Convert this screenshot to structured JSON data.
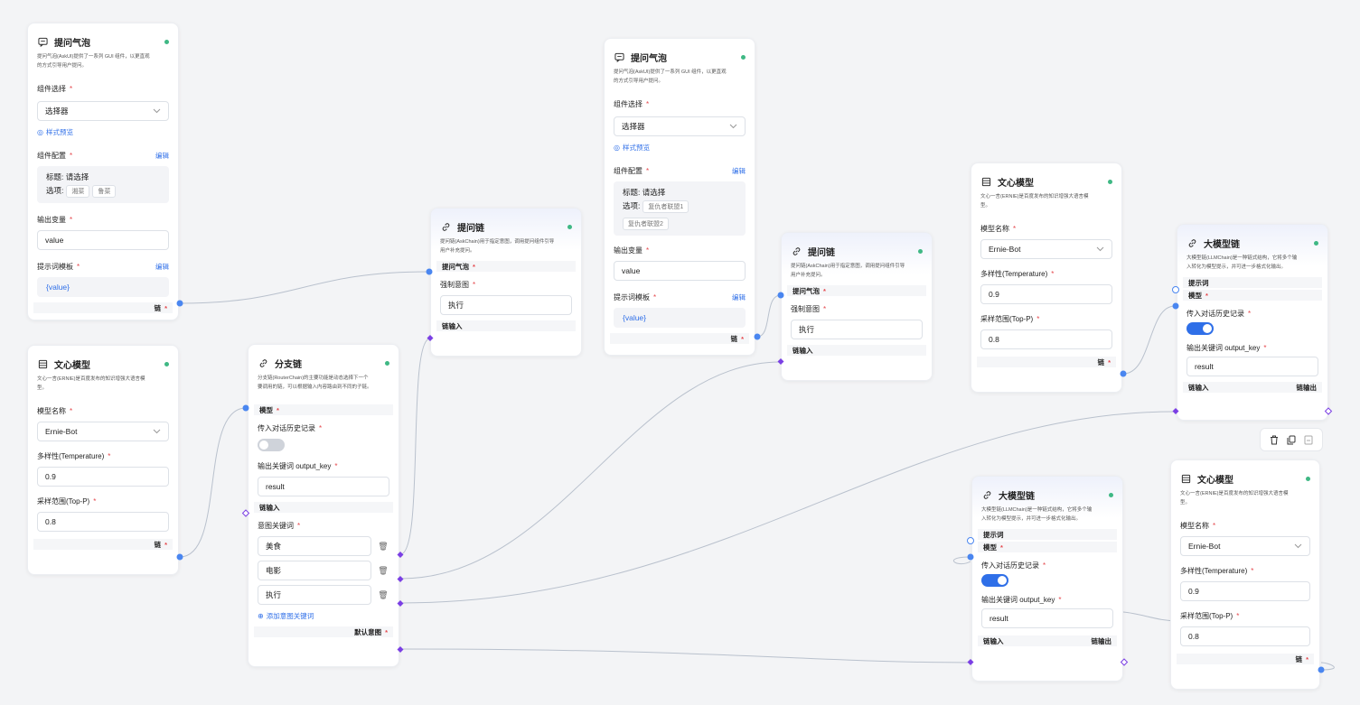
{
  "nodes": {
    "askui1": {
      "title": "提问气泡",
      "desc": [
        "提问气泡(AskUI)提供了一系列 GUI 组件，以更直观",
        "的方式引导用户提问。"
      ],
      "component_label": "组件选择",
      "component_value": "选择器",
      "style_preview": "样式预览",
      "config_label": "组件配置",
      "edit": "编辑",
      "config_title": "标题: 请选择",
      "config_options_label": "选项:",
      "options": [
        "湘菜",
        "鲁菜"
      ],
      "output_label": "输出变量",
      "output_value": "value",
      "template_label": "提示词模板",
      "template_value": "{value}",
      "chain_port": "链"
    },
    "askui2": {
      "title": "提问气泡",
      "desc": [
        "提问气泡(AskUI)提供了一系列 GUI 组件，以更直观",
        "的方式引导用户提问。"
      ],
      "component_label": "组件选择",
      "component_value": "选择器",
      "style_preview": "样式预览",
      "config_label": "组件配置",
      "edit": "编辑",
      "config_title": "标题: 请选择",
      "config_options_label": "选项:",
      "options": [
        "复仇者联盟1",
        "复仇者联盟2"
      ],
      "output_label": "输出变量",
      "output_value": "value",
      "template_label": "提示词模板",
      "template_value": "{value}",
      "chain_port": "链"
    },
    "wenxin1": {
      "title": "文心模型",
      "desc": [
        "文心一言(ERNIE)是百度发布的知识增强大语言模",
        "型。"
      ],
      "model_label": "模型名称",
      "model_value": "Ernie-Bot",
      "temp_label": "多样性(Temperature)",
      "temp_value": "0.9",
      "topp_label": "采样范围(Top-P)",
      "topp_value": "0.8",
      "chain_port": "链"
    },
    "wenxin2": {
      "title": "文心模型",
      "desc": [
        "文心一言(ERNIE)是百度发布的知识增强大语言模",
        "型。"
      ],
      "model_label": "模型名称",
      "model_value": "Ernie-Bot",
      "temp_label": "多样性(Temperature)",
      "temp_value": "0.9",
      "topp_label": "采样范围(Top-P)",
      "topp_value": "0.8",
      "chain_port": "链"
    },
    "wenxin3": {
      "title": "文心模型",
      "desc": [
        "文心一言(ERNIE)是百度发布的知识增强大语言模",
        "型。"
      ],
      "model_label": "模型名称",
      "model_value": "Ernie-Bot",
      "temp_label": "多样性(Temperature)",
      "temp_value": "0.9",
      "topp_label": "采样范围(Top-P)",
      "topp_value": "0.8",
      "chain_port": "链"
    },
    "router": {
      "title": "分支链",
      "desc": [
        "分支链(RouterChain)的主要功能是动态选择下一个",
        "要调用的链，可以根据输入内容路由到不同的子链。"
      ],
      "model_port": "模型",
      "history_label": "传入对话历史记录",
      "history_on": false,
      "output_key_label": "输出关键词 output_key",
      "output_key_value": "result",
      "chain_in": "链输入",
      "intent_label": "意图关键词",
      "keywords": [
        "美食",
        "电影",
        "执行"
      ],
      "add_keyword": "添加意图关键词",
      "default_intent": "默认意图"
    },
    "askchain1": {
      "title": "提问链",
      "desc": [
        "提问链(AskChain)用于指定意图，调用提问组件引导",
        "用户补充提问。"
      ],
      "askui_port": "提问气泡",
      "intent_label": "强制意图",
      "intent_value": "执行",
      "chain_in": "链输入"
    },
    "askchain2": {
      "title": "提问链",
      "desc": [
        "提问链(AskChain)用于指定意图，调用提问组件引导",
        "用户补充提问。"
      ],
      "askui_port": "提问气泡",
      "intent_label": "强制意图",
      "intent_value": "执行",
      "chain_in": "链输入"
    },
    "llm1": {
      "title": "大模型链",
      "desc": [
        "大模型链(LLMChain)是一种链式结构，它将多个输",
        "入转化为模型提示，并可进一步格式化输出。"
      ],
      "prompt_port": "提示词",
      "model_port": "模型",
      "history_label": "传入对话历史记录",
      "history_on": true,
      "output_key_label": "输出关键词 output_key",
      "output_key_value": "result",
      "chain_in": "链输入",
      "chain_out": "链输出"
    },
    "llm2": {
      "title": "大模型链",
      "desc": [
        "大模型链(LLMChain)是一种链式结构，它将多个输",
        "入转化为模型提示，并可进一步格式化输出。"
      ],
      "prompt_port": "提示词",
      "model_port": "模型",
      "history_label": "传入对话历史记录",
      "history_on": true,
      "output_key_label": "输出关键词 output_key",
      "output_key_value": "result",
      "chain_in": "链输入",
      "chain_out": "链输出"
    }
  },
  "colors": {
    "accent": "#2f6fe8",
    "status_dot": "#3fb884",
    "required": "#e5484d",
    "chain_port": "#7b3fe4",
    "edge": "#aeb6c4"
  },
  "toolbar": {
    "icons": [
      "trash-icon",
      "copy-icon",
      "save-icon"
    ]
  }
}
